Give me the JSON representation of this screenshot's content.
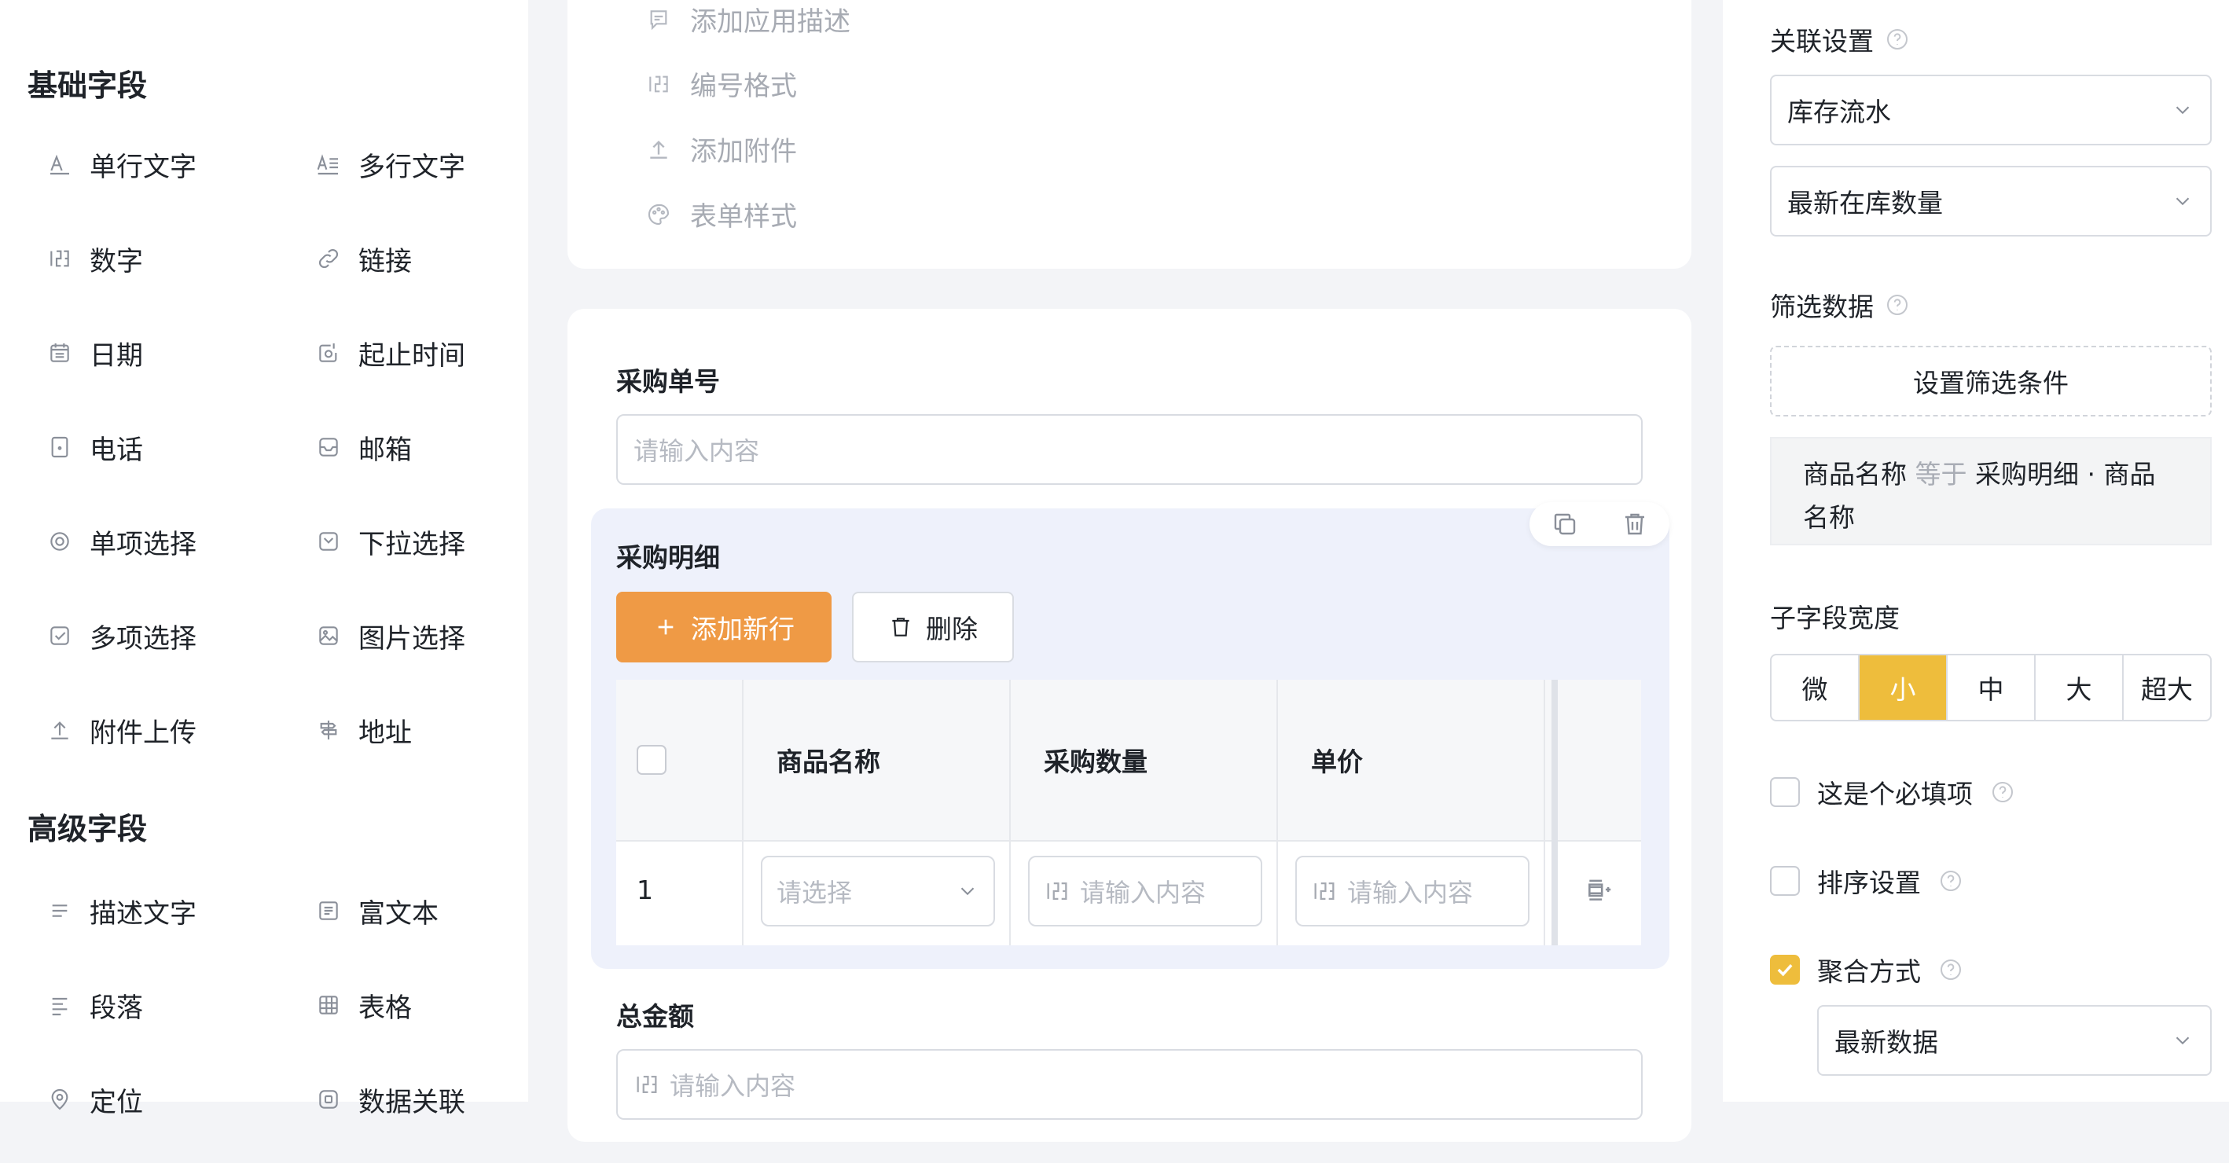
{
  "left": {
    "basic_title": "基础字段",
    "basic_fields": [
      {
        "label": "单行文字",
        "icon": "single-line-text-icon"
      },
      {
        "label": "多行文字",
        "icon": "multi-line-text-icon"
      },
      {
        "label": "数字",
        "icon": "number-icon"
      },
      {
        "label": "链接",
        "icon": "link-icon"
      },
      {
        "label": "日期",
        "icon": "calendar-icon"
      },
      {
        "label": "起止时间",
        "icon": "date-range-icon"
      },
      {
        "label": "电话",
        "icon": "phone-icon"
      },
      {
        "label": "邮箱",
        "icon": "mail-icon"
      },
      {
        "label": "单项选择",
        "icon": "radio-icon"
      },
      {
        "label": "下拉选择",
        "icon": "dropdown-icon"
      },
      {
        "label": "多项选择",
        "icon": "checkbox-icon"
      },
      {
        "label": "图片选择",
        "icon": "image-icon"
      },
      {
        "label": "附件上传",
        "icon": "upload-icon"
      },
      {
        "label": "地址",
        "icon": "signpost-icon"
      }
    ],
    "advanced_title": "高级字段",
    "advanced_fields": [
      {
        "label": "描述文字",
        "icon": "description-icon"
      },
      {
        "label": "富文本",
        "icon": "rich-text-icon"
      },
      {
        "label": "段落",
        "icon": "paragraph-icon"
      },
      {
        "label": "表格",
        "icon": "table-icon"
      },
      {
        "label": "定位",
        "icon": "location-icon"
      },
      {
        "label": "数据关联",
        "icon": "data-link-icon"
      }
    ]
  },
  "center": {
    "top_menu": [
      {
        "label": "添加应用描述",
        "icon": "comment-icon"
      },
      {
        "label": "编号格式",
        "icon": "number-format-icon"
      },
      {
        "label": "添加附件",
        "icon": "upload-icon"
      },
      {
        "label": "表单样式",
        "icon": "palette-icon"
      }
    ],
    "order_no": {
      "label": "采购单号",
      "placeholder": "请输入内容"
    },
    "detail": {
      "title": "采购明细",
      "add_row": "添加新行",
      "delete": "删除",
      "columns": [
        "商品名称",
        "采购数量",
        "单价"
      ],
      "rows": [
        {
          "index": "1",
          "product_placeholder": "请选择",
          "qty_placeholder": "请输入内容",
          "price_placeholder": "请输入内容"
        }
      ]
    },
    "total": {
      "label": "总金额",
      "placeholder": "请输入内容"
    }
  },
  "right": {
    "relation": {
      "title": "关联设置",
      "source": "库存流水",
      "field": "最新在库数量"
    },
    "filter": {
      "title": "筛选数据",
      "button": "设置筛选条件",
      "cond_field": "商品名称",
      "cond_op": "等于",
      "cond_value": "采购明细 · 商品名称"
    },
    "width": {
      "title": "子字段宽度",
      "options": [
        "微",
        "小",
        "中",
        "大",
        "超大"
      ],
      "selected": "小"
    },
    "required": {
      "label": "这是个必填项",
      "checked": false
    },
    "sort": {
      "label": "排序设置",
      "checked": false
    },
    "aggregate": {
      "label": "聚合方式",
      "checked": true,
      "value": "最新数据"
    },
    "accent_color": "#eebd3c",
    "primary_button_color": "#ef9a45"
  }
}
